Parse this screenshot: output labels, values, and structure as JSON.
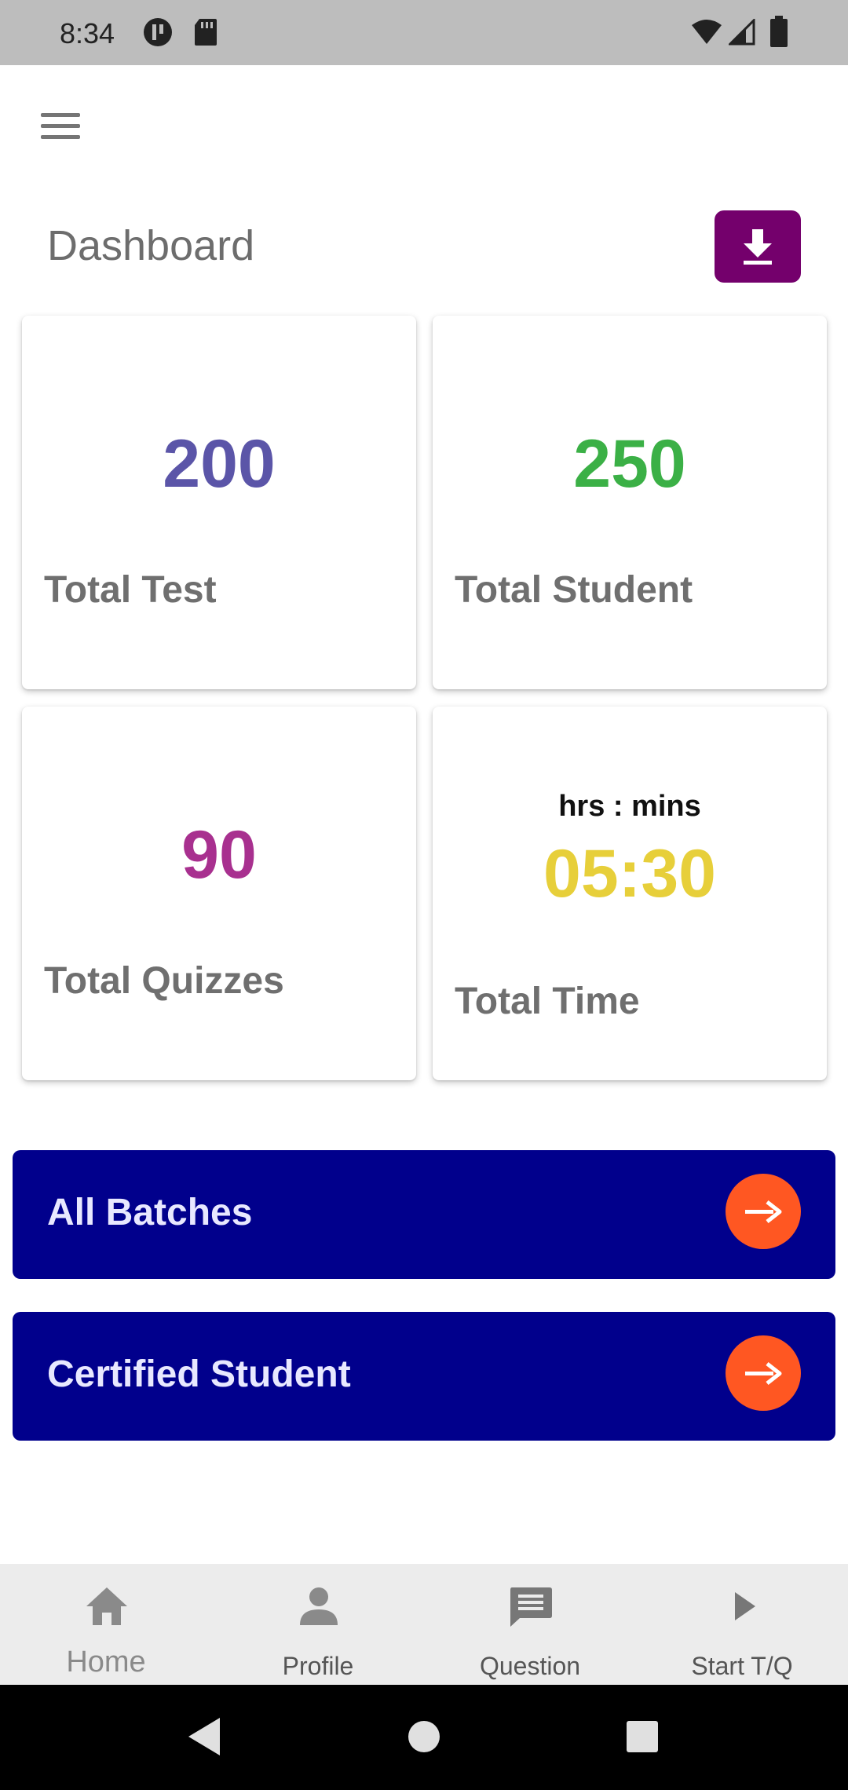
{
  "status_bar": {
    "time": "8:34",
    "icons": [
      "app-circle-icon",
      "sd-card-icon",
      "wifi-icon",
      "signal-icon",
      "battery-icon"
    ]
  },
  "header": {
    "menu_icon": "hamburger-menu-icon",
    "title": "Dashboard",
    "download_icon": "download-icon",
    "accent_color": "#74006c"
  },
  "stats": [
    {
      "value": "200",
      "label": "Total Test",
      "color": "#5b55a8"
    },
    {
      "value": "250",
      "label": "Total Student",
      "color": "#3bb046"
    },
    {
      "value": "90",
      "label": "Total Quizzes",
      "color": "#a8308f"
    },
    {
      "value": "05:30",
      "unit": "hrs : mins",
      "label": "Total Time",
      "color": "#e7cf3a"
    }
  ],
  "actions": [
    {
      "label": "All Batches",
      "icon": "arrow-right-icon"
    },
    {
      "label": "Certified Student",
      "icon": "arrow-right-icon"
    }
  ],
  "colors": {
    "action_bg": "#01008c",
    "arrow_button": "#ff5722"
  },
  "bottom_nav": [
    {
      "label": "Home",
      "icon": "home-icon",
      "active": true
    },
    {
      "label": "Profile",
      "icon": "person-icon",
      "active": false
    },
    {
      "label": "Question",
      "icon": "message-icon",
      "active": false
    },
    {
      "label": "Start T/Q",
      "icon": "play-icon",
      "active": false
    }
  ],
  "system_nav": [
    "back-icon",
    "home-circle-icon",
    "recents-icon"
  ]
}
